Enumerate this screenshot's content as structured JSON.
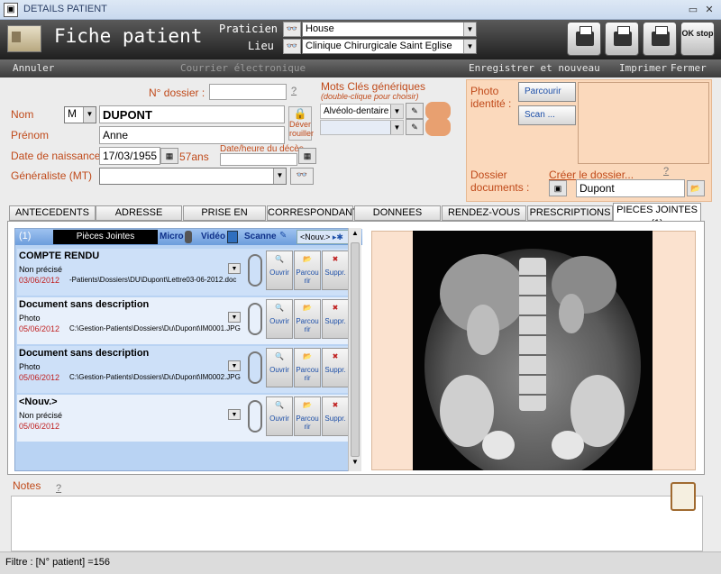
{
  "window": {
    "title": "DETAILS PATIENT"
  },
  "header": {
    "title": "Fiche patient",
    "praticien_label": "Praticien :",
    "praticien_value": "House",
    "lieu_label": "Lieu :",
    "lieu_value": "Clinique Chirurgicale Saint Eglise",
    "stop_label": "OK stop"
  },
  "menu": {
    "annuler": "Annuler",
    "courrier": "Courrier électronique",
    "enregistrer": "Enregistrer et nouveau",
    "imprimer": "Imprimer",
    "fermer": "Fermer"
  },
  "form": {
    "dossier_label": "N° dossier :",
    "dossier_value": "",
    "nom_label": "Nom",
    "civilite": "M",
    "nom_value": "DUPONT",
    "deverrouiller": "Déver rouiller",
    "prenom_label": "Prénom",
    "prenom_value": "Anne",
    "naissance_label": "Date de naissance",
    "naissance_value": "17/03/1955",
    "age": "57ans",
    "deces_label": "Date/heure du décès",
    "generaliste_label": "Généraliste (MT)",
    "generaliste_value": "",
    "qmark": "?"
  },
  "motscles": {
    "title": "Mots Clés génériques",
    "hint": "(double-clique pour choisir)",
    "value1": "Alvéolo-dentaire",
    "value2": ""
  },
  "photo": {
    "label": "Photo identité :",
    "parcourir": "Parcourir",
    "scan": "Scan ...",
    "dossier_docs_label": "Dossier documents :",
    "creer_label": "Créer le dossier...",
    "dossier_docs_value": "Dupont"
  },
  "tabs": [
    "ANTECEDENTS",
    "ADRESSE",
    "PRISE EN CHARGE",
    "CORRESPONDANTS",
    "DONNEES",
    "RENDEZ-VOUS (7)",
    "PRESCRIPTIONS (1)",
    "PIECES JOINTES (1)"
  ],
  "pieces": {
    "count": "(1)",
    "header": "Pièces Jointes",
    "micro": "Micro",
    "video": "Vidéo",
    "scanne": "Scanne",
    "nouv": "<Nouv.>",
    "actions": {
      "ouvrir": "Ouvrir",
      "parcourir": "Parcou rir",
      "suppr": "Suppr."
    },
    "docs": [
      {
        "title": "COMPTE RENDU",
        "type": "Non précisé",
        "date": "03/06/2012",
        "path": "-Patients\\Dossiers\\DU\\Dupont\\Lettre03-06-2012.doc"
      },
      {
        "title": "Document sans description",
        "type": "Photo",
        "date": "05/06/2012",
        "path": "C:\\Gestion-Patients\\Dossiers\\Du\\Dupont\\IM0001.JPG"
      },
      {
        "title": "Document sans description",
        "type": "Photo",
        "date": "05/06/2012",
        "path": "C:\\Gestion-Patients\\Dossiers\\Du\\Dupont\\IM0002.JPG"
      },
      {
        "title": "<Nouv.>",
        "type": "Non précisé",
        "date": "05/06/2012",
        "path": ""
      }
    ]
  },
  "notes": {
    "label": "Notes",
    "qmark": "?"
  },
  "status": {
    "filter": "Filtre : [N° patient] =156"
  }
}
